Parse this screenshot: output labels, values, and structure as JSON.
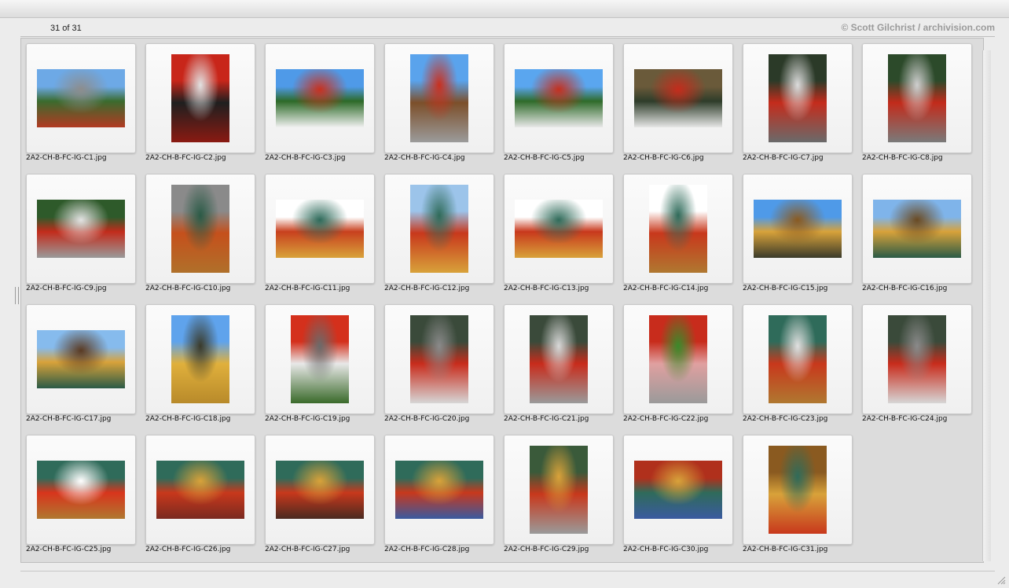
{
  "header": {
    "count_label": "31 of 31",
    "credit": "© Scott Gilchrist / archivision.com"
  },
  "thumbnails": [
    {
      "name": "2A2-CH-B-FC-IG-C1.jpg",
      "orientation": "landscape",
      "colors": [
        "#6da9e6",
        "#3a6b2e",
        "#8d8d8d",
        "#b23a22"
      ]
    },
    {
      "name": "2A2-CH-B-FC-IG-C2.jpg",
      "orientation": "portrait",
      "colors": [
        "#c8261a",
        "#1f1f1f",
        "#e2e2e2",
        "#8a1a12"
      ]
    },
    {
      "name": "2A2-CH-B-FC-IG-C3.jpg",
      "orientation": "landscape",
      "colors": [
        "#4f9ae8",
        "#2d6a28",
        "#c8311f",
        "#f0f0f0"
      ]
    },
    {
      "name": "2A2-CH-B-FC-IG-C4.jpg",
      "orientation": "portrait",
      "colors": [
        "#5aa3ec",
        "#7c4f2a",
        "#c9301e",
        "#9b9b9b"
      ]
    },
    {
      "name": "2A2-CH-B-FC-IG-C5.jpg",
      "orientation": "landscape",
      "colors": [
        "#5aa6ef",
        "#2f6b2a",
        "#c4301f",
        "#e8e8e8"
      ]
    },
    {
      "name": "2A2-CH-B-FC-IG-C6.jpg",
      "orientation": "landscape",
      "colors": [
        "#6a5a3a",
        "#2e3d2a",
        "#c42c1c",
        "#e6e6e6"
      ]
    },
    {
      "name": "2A2-CH-B-FC-IG-C7.jpg",
      "orientation": "portrait",
      "colors": [
        "#2b3a28",
        "#c42c1c",
        "#dcdcdc",
        "#6a6a6a"
      ]
    },
    {
      "name": "2A2-CH-B-FC-IG-C8.jpg",
      "orientation": "portrait",
      "colors": [
        "#2c4a2a",
        "#c22b1b",
        "#cfcfcf",
        "#7a7a7a"
      ]
    },
    {
      "name": "2A2-CH-B-FC-IG-C9.jpg",
      "orientation": "landscape",
      "colors": [
        "#2e5a2a",
        "#c22b1b",
        "#e3e3e3",
        "#9a9a9a"
      ]
    },
    {
      "name": "2A2-CH-B-FC-IG-C10.jpg",
      "orientation": "portrait",
      "colors": [
        "#8a8a8a",
        "#c5501c",
        "#2a5a46",
        "#b0702a"
      ]
    },
    {
      "name": "2A2-CH-B-FC-IG-C11.jpg",
      "orientation": "landscape",
      "colors": [
        "#ffffff",
        "#c8401e",
        "#2d6a5a",
        "#d8a23a"
      ]
    },
    {
      "name": "2A2-CH-B-FC-IG-C12.jpg",
      "orientation": "portrait",
      "colors": [
        "#9cc4ea",
        "#c8381c",
        "#2f6b5a",
        "#d8a23a"
      ]
    },
    {
      "name": "2A2-CH-B-FC-IG-C13.jpg",
      "orientation": "landscape",
      "colors": [
        "#ffffff",
        "#c8381c",
        "#2f6b5a",
        "#d8a23a"
      ]
    },
    {
      "name": "2A2-CH-B-FC-IG-C14.jpg",
      "orientation": "portrait",
      "colors": [
        "#ffffff",
        "#c8381c",
        "#2f6b5a",
        "#b07830"
      ]
    },
    {
      "name": "2A2-CH-B-FC-IG-C15.jpg",
      "orientation": "landscape",
      "colors": [
        "#4f9ae8",
        "#d8a23a",
        "#8a5a20",
        "#3a3a2a"
      ]
    },
    {
      "name": "2A2-CH-B-FC-IG-C16.jpg",
      "orientation": "landscape",
      "colors": [
        "#7fb4ea",
        "#d8a23a",
        "#6a4a22",
        "#2a5a46"
      ]
    },
    {
      "name": "2A2-CH-B-FC-IG-C17.jpg",
      "orientation": "landscape",
      "colors": [
        "#86bbed",
        "#d8a23a",
        "#5a3a22",
        "#2a5a46"
      ]
    },
    {
      "name": "2A2-CH-B-FC-IG-C18.jpg",
      "orientation": "portrait",
      "colors": [
        "#5fa3ec",
        "#e0b03c",
        "#3a3a2a",
        "#b88a2a"
      ]
    },
    {
      "name": "2A2-CH-B-FC-IG-C19.jpg",
      "orientation": "portrait",
      "colors": [
        "#d4301c",
        "#e8e8e8",
        "#6a6a6a",
        "#3a6a2a"
      ]
    },
    {
      "name": "2A2-CH-B-FC-IG-C20.jpg",
      "orientation": "portrait",
      "colors": [
        "#3a4a3a",
        "#c82c1c",
        "#8a8a8a",
        "#d6d6d6"
      ]
    },
    {
      "name": "2A2-CH-B-FC-IG-C21.jpg",
      "orientation": "portrait",
      "colors": [
        "#3a4a3a",
        "#c82c1c",
        "#d8d8d8",
        "#9a9a9a"
      ]
    },
    {
      "name": "2A2-CH-B-FC-IG-C22.jpg",
      "orientation": "portrait",
      "colors": [
        "#c82c1c",
        "#e0a0a0",
        "#3a8a2a",
        "#9a9a9a"
      ]
    },
    {
      "name": "2A2-CH-B-FC-IG-C23.jpg",
      "orientation": "portrait",
      "colors": [
        "#2f6b5a",
        "#c8381c",
        "#e0e0e0",
        "#b07830"
      ]
    },
    {
      "name": "2A2-CH-B-FC-IG-C24.jpg",
      "orientation": "portrait",
      "colors": [
        "#3a4a3a",
        "#c82c1c",
        "#8a8a8a",
        "#d6d6d6"
      ]
    },
    {
      "name": "2A2-CH-B-FC-IG-C25.jpg",
      "orientation": "landscape",
      "colors": [
        "#2f6b5a",
        "#d8341c",
        "#ffffff",
        "#b07830"
      ]
    },
    {
      "name": "2A2-CH-B-FC-IG-C26.jpg",
      "orientation": "landscape",
      "colors": [
        "#2f6b5a",
        "#c8381c",
        "#d8a23a",
        "#7a2a20"
      ]
    },
    {
      "name": "2A2-CH-B-FC-IG-C27.jpg",
      "orientation": "landscape",
      "colors": [
        "#2f6b5a",
        "#c8381c",
        "#d8a23a",
        "#4a2a20"
      ]
    },
    {
      "name": "2A2-CH-B-FC-IG-C28.jpg",
      "orientation": "landscape",
      "colors": [
        "#2f6b5a",
        "#c8381c",
        "#d8a23a",
        "#3a5aa0"
      ]
    },
    {
      "name": "2A2-CH-B-FC-IG-C29.jpg",
      "orientation": "portrait",
      "colors": [
        "#3a5a3a",
        "#c8381c",
        "#d8a23a",
        "#9a9a9a"
      ]
    },
    {
      "name": "2A2-CH-B-FC-IG-C30.jpg",
      "orientation": "landscape",
      "colors": [
        "#b0301c",
        "#2f6b5a",
        "#d8a23a",
        "#3a5aa0"
      ]
    },
    {
      "name": "2A2-CH-B-FC-IG-C31.jpg",
      "orientation": "portrait",
      "colors": [
        "#8a5a20",
        "#d8a23a",
        "#2f6b5a",
        "#c8381c"
      ]
    }
  ]
}
